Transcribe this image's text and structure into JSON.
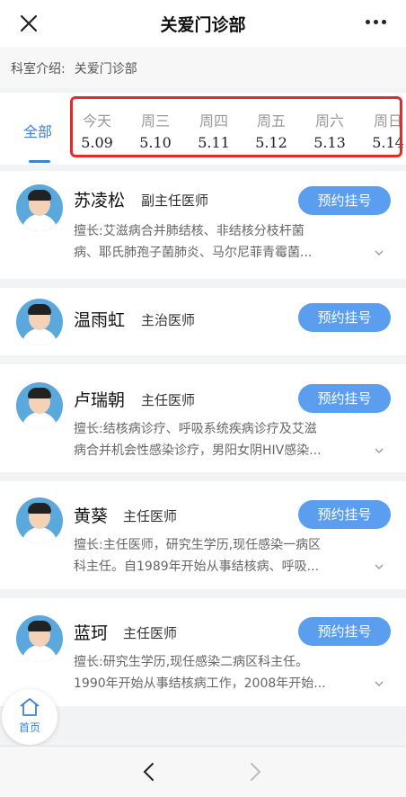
{
  "header": {
    "title": "关爱门诊部"
  },
  "intro": {
    "label": "科室介绍:",
    "value": "关爱门诊部"
  },
  "tabs": {
    "all": "全部",
    "days": [
      {
        "weekday": "今天",
        "date": "5.09"
      },
      {
        "weekday": "周三",
        "date": "5.10"
      },
      {
        "weekday": "周四",
        "date": "5.11"
      },
      {
        "weekday": "周五",
        "date": "5.12"
      },
      {
        "weekday": "周六",
        "date": "5.13"
      },
      {
        "weekday": "周日",
        "date": "5.14"
      }
    ]
  },
  "book_label": "预约挂号",
  "doctors": [
    {
      "name": "苏凌松",
      "rank": "副主任医师",
      "spec1": "擅长:艾滋病合并肺结核、非结核分枝杆菌",
      "spec2": "病、耶氏肺孢子菌肺炎、马尔尼菲青霉菌..."
    },
    {
      "name": "温雨虹",
      "rank": "主治医师"
    },
    {
      "name": "卢瑞朝",
      "rank": "主任医师",
      "spec1": "擅长:结核病诊疗、呼吸系统疾病诊疗及艾滋",
      "spec2": "病合并机会性感染诊疗，男阳女阴HIV感染..."
    },
    {
      "name": "黄葵",
      "rank": "主任医师",
      "spec1": "擅长:主任医师，研究生学历,现任感染一病区",
      "spec2": "科主任。自1989年开始从事结核病、呼吸..."
    },
    {
      "name": "蓝珂",
      "rank": "主任医师",
      "spec1": "擅长:研究生学历,现任感染二病区科主任。",
      "spec2": "1990年开始从事结核病工作，2008年开始..."
    }
  ],
  "home": {
    "label": "首页"
  }
}
